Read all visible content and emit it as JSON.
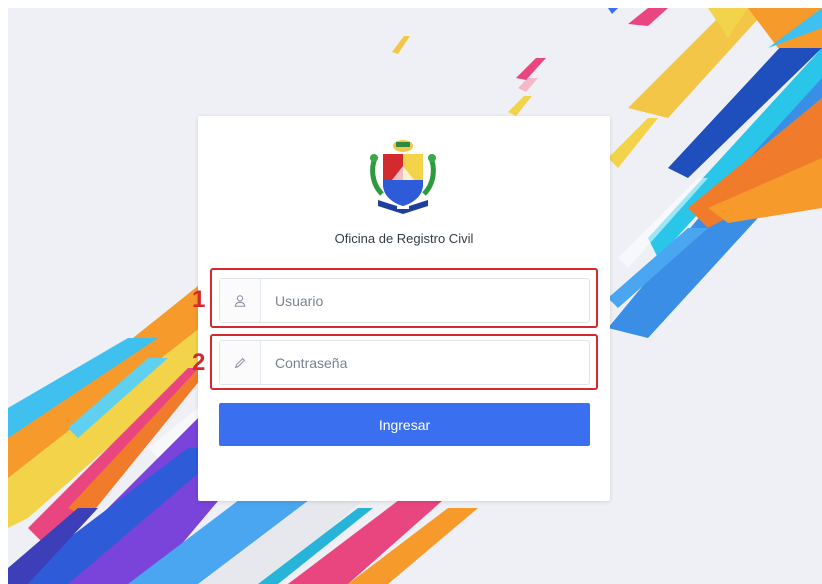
{
  "login": {
    "office_name": "Oficina de Registro Civil",
    "username": {
      "placeholder": "Usuario",
      "icon": "user-icon"
    },
    "password": {
      "placeholder": "Contraseña",
      "icon": "pencil-icon"
    },
    "submit_label": "Ingresar"
  },
  "annotations": {
    "first": "1",
    "second": "2"
  },
  "colors": {
    "accent": "#3a6ff0",
    "annotation": "#d3292f",
    "background": "#eef0f5"
  }
}
